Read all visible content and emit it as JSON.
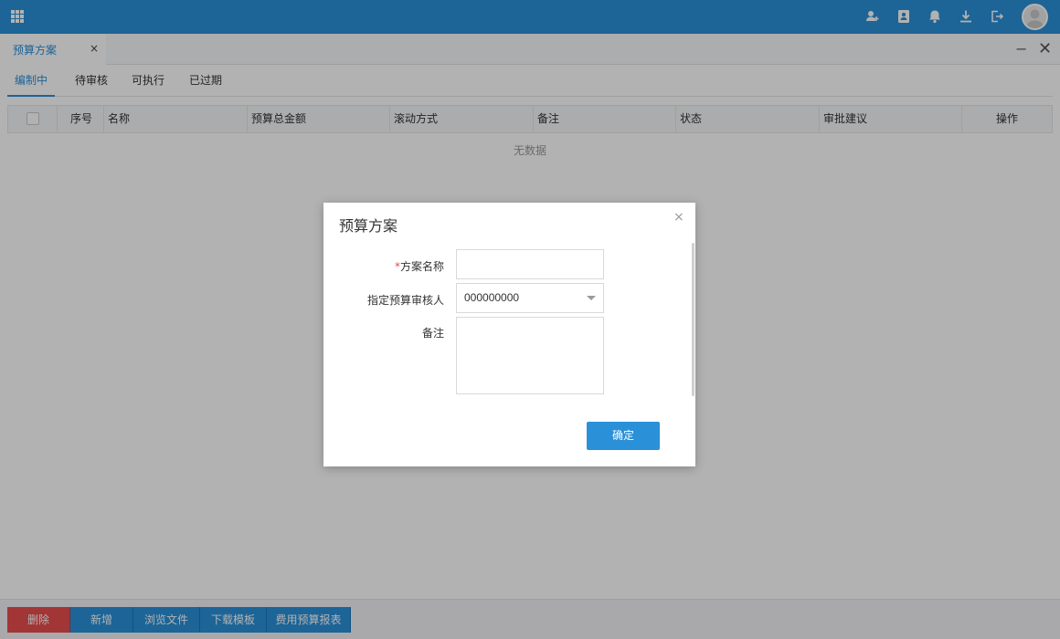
{
  "header": {
    "icons": [
      "apps-grid-icon",
      "add-user-icon",
      "contacts-icon",
      "bell-icon",
      "download-icon",
      "logout-icon",
      "avatar"
    ]
  },
  "tabs": {
    "active_label": "预算方案",
    "close_symbol": "×",
    "minimize_symbol": "−",
    "window_close_symbol": "✕"
  },
  "subtabs": [
    {
      "label": "编制中",
      "active": true
    },
    {
      "label": "待审核",
      "active": false
    },
    {
      "label": "可执行",
      "active": false
    },
    {
      "label": "已过期",
      "active": false
    }
  ],
  "table": {
    "columns": [
      "序号",
      "名称",
      "预算总金额",
      "滚动方式",
      "备注",
      "状态",
      "审批建议",
      "操作"
    ],
    "empty_text": "无数据"
  },
  "toolbar": {
    "delete_label": "删除",
    "add_label": "新增",
    "browse_label": "浏览文件",
    "download_template_label": "下载模板",
    "report_label": "费用预算报表"
  },
  "dialog": {
    "title": "预算方案",
    "close_symbol": "×",
    "required_mark": "*",
    "name_label": "方案名称",
    "name_value": "",
    "reviewer_label": "指定预算审核人",
    "reviewer_value": "000000000",
    "remark_label": "备注",
    "remark_value": "",
    "confirm_label": "确定"
  },
  "colors": {
    "primary": "#2a90d8",
    "danger": "#e84c4c",
    "overlay": "rgba(0,0,0,0.30)"
  }
}
